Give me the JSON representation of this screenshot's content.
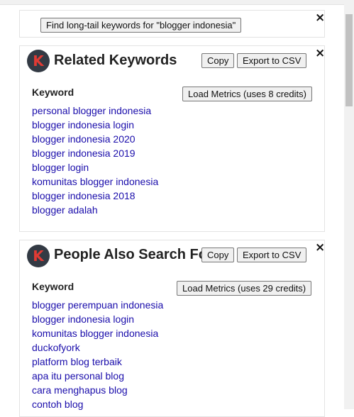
{
  "longtail": {
    "button_label": "Find long-tail keywords for \"blogger indonesia\"",
    "close_glyph": "×"
  },
  "related": {
    "logo_letter": "K",
    "title": "Related Keywords",
    "copy_label": "Copy",
    "export_label": "Export to CSV",
    "close_glyph": "×",
    "column_header": "Keyword",
    "load_metrics_label": "Load Metrics (uses 8 credits)",
    "keywords": [
      "personal blogger indonesia",
      "blogger indonesia login",
      "blogger indonesia 2020",
      "blogger indonesia 2019",
      "blogger login",
      "komunitas blogger indonesia",
      "blogger indonesia 2018",
      "blogger adalah"
    ]
  },
  "people_also_search": {
    "logo_letter": "K",
    "title": "People Also Search For",
    "copy_label": "Copy",
    "export_label": "Export to CSV",
    "close_glyph": "×",
    "column_header": "Keyword",
    "load_metrics_label": "Load Metrics (uses 29 credits)",
    "keywords": [
      "blogger perempuan indonesia",
      "blogger indonesia login",
      "komunitas blogger indonesia",
      "duckofyork",
      "platform blog terbaik",
      "apa itu personal blog",
      "cara menghapus blog",
      "contoh blog"
    ]
  },
  "colors": {
    "link": "#1a0dab",
    "logo_bg": "#333a44",
    "logo_letter": "#e03a34"
  }
}
